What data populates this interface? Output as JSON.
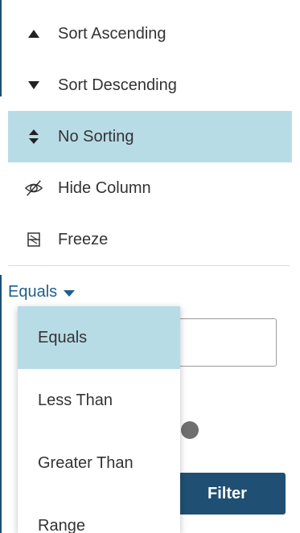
{
  "column_menu": {
    "items": [
      {
        "label": "Sort Ascending",
        "icon": "sort-ascending-icon",
        "active": false
      },
      {
        "label": "Sort Descending",
        "icon": "sort-descending-icon",
        "active": false
      },
      {
        "label": "No Sorting",
        "icon": "no-sorting-icon",
        "active": true
      },
      {
        "label": "Hide Column",
        "icon": "hide-column-icon",
        "active": false
      },
      {
        "label": "Freeze",
        "icon": "freeze-icon",
        "active": false
      }
    ]
  },
  "filter": {
    "operator_label": "Equals",
    "operator_options": [
      {
        "label": "Equals",
        "selected": true
      },
      {
        "label": "Less Than",
        "selected": false
      },
      {
        "label": "Greater Than",
        "selected": false
      },
      {
        "label": "Range",
        "selected": false
      }
    ],
    "value": "",
    "button_label": "Filter"
  },
  "colors": {
    "accent": "#1f4f73",
    "selected_background": "#b8dce6",
    "link": "#1f5f8b"
  }
}
